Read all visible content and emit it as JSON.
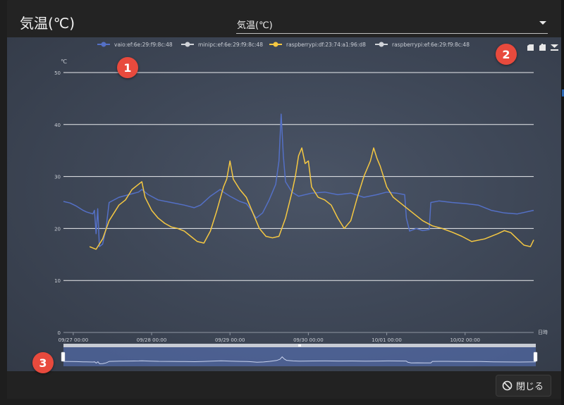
{
  "modal": {
    "title": "気温(℃)",
    "select_value": "気温(℃)",
    "close_label": "閉じる",
    "badges": [
      "1",
      "2",
      "3"
    ]
  },
  "chart_data": {
    "type": "line",
    "yunit": "℃",
    "xlabel": "日時",
    "ylim": [
      0,
      50
    ],
    "yticks": [
      0,
      10,
      20,
      30,
      40,
      50
    ],
    "xlim": [
      "09/26 21:00",
      "10/02 21:00"
    ],
    "xticks": [
      "09/27 00:00",
      "09/28 00:00",
      "09/29 00:00",
      "09/30 00:00",
      "10/01 00:00",
      "10/02 00:00"
    ],
    "legend_position": "top-center",
    "grid": true,
    "series": [
      {
        "name": "vaio:ef:6e:29:f9:8c:48",
        "color": "#5470c6",
        "points": [
          [
            "09/26 21:00",
            25.2
          ],
          [
            "09/26 23:00",
            24.9
          ],
          [
            "09/27 01:00",
            24.3
          ],
          [
            "09/27 03:00",
            23.5
          ],
          [
            "09/27 04:00",
            23.2
          ],
          [
            "09/27 05:00",
            23.0
          ],
          [
            "09/27 06:00",
            22.8
          ],
          [
            "09/27 06:30",
            23.5
          ],
          [
            "09/27 07:00",
            19.0
          ],
          [
            "09/27 07:30",
            23.8
          ],
          [
            "09/27 08:00",
            16.5
          ],
          [
            "09/27 09:00",
            17.0
          ],
          [
            "09/27 10:00",
            19.8
          ],
          [
            "09/27 11:00",
            25.0
          ],
          [
            "09/27 14:00",
            26.0
          ],
          [
            "09/27 17:00",
            26.5
          ],
          [
            "09/27 20:00",
            27.0
          ],
          [
            "09/27 21:00",
            27.5
          ],
          [
            "09/27 23:00",
            26.5
          ],
          [
            "09/28 02:00",
            25.5
          ],
          [
            "09/28 06:00",
            25.0
          ],
          [
            "09/28 10:00",
            24.5
          ],
          [
            "09/28 13:00",
            24.0
          ],
          [
            "09/28 15:00",
            24.5
          ],
          [
            "09/28 18:00",
            26.2
          ],
          [
            "09/28 21:00",
            27.5
          ],
          [
            "09/28 22:00",
            27.0
          ],
          [
            "09/29 00:00",
            26.2
          ],
          [
            "09/29 03:00",
            25.2
          ],
          [
            "09/29 05:00",
            24.8
          ],
          [
            "09/29 06:00",
            24.0
          ],
          [
            "09/29 08:00",
            22.0
          ],
          [
            "09/29 10:00",
            23.0
          ],
          [
            "09/29 12:00",
            25.5
          ],
          [
            "09/29 14:00",
            28.5
          ],
          [
            "09/29 15:00",
            33.0
          ],
          [
            "09/29 15:40",
            42.0
          ],
          [
            "09/29 16:20",
            34.0
          ],
          [
            "09/29 17:00",
            29.0
          ],
          [
            "09/29 19:00",
            27.0
          ],
          [
            "09/29 21:00",
            26.2
          ],
          [
            "09/30 01:00",
            26.8
          ],
          [
            "09/30 05:00",
            27.0
          ],
          [
            "09/30 09:00",
            26.5
          ],
          [
            "09/30 13:00",
            26.8
          ],
          [
            "09/30 17:00",
            26.0
          ],
          [
            "09/30 21:00",
            26.5
          ],
          [
            "10/01 00:00",
            27.0
          ],
          [
            "10/01 03:00",
            26.8
          ],
          [
            "10/01 05:30",
            26.5
          ],
          [
            "10/01 06:00",
            22.0
          ],
          [
            "10/01 07:00",
            19.5
          ],
          [
            "10/01 09:00",
            20.0
          ],
          [
            "10/01 11:00",
            19.6
          ],
          [
            "10/01 13:00",
            19.8
          ],
          [
            "10/01 13:30",
            25.0
          ],
          [
            "10/01 16:00",
            25.3
          ],
          [
            "10/01 20:00",
            25.0
          ],
          [
            "10/02 00:00",
            24.8
          ],
          [
            "10/02 04:00",
            24.5
          ],
          [
            "10/02 08:00",
            23.5
          ],
          [
            "10/02 12:00",
            23.0
          ],
          [
            "10/02 16:00",
            22.8
          ],
          [
            "10/02 21:00",
            23.5
          ]
        ]
      },
      {
        "name": "minipc:ef:6e:29:f9:8c:48",
        "color": "#d0d3d8",
        "points": []
      },
      {
        "name": "raspberrypi:df:23:74:a1:96:d8",
        "color": "#f5c842",
        "points": [
          [
            "09/27 05:00",
            16.5
          ],
          [
            "09/27 07:00",
            16.0
          ],
          [
            "09/27 09:00",
            18.0
          ],
          [
            "09/27 11:00",
            21.5
          ],
          [
            "09/27 14:00",
            24.5
          ],
          [
            "09/27 16:00",
            25.5
          ],
          [
            "09/27 18:00",
            27.5
          ],
          [
            "09/27 20:00",
            28.5
          ],
          [
            "09/27 21:00",
            29.0
          ],
          [
            "09/27 22:00",
            26.0
          ],
          [
            "09/28 00:00",
            23.5
          ],
          [
            "09/28 02:00",
            22.0
          ],
          [
            "09/28 04:00",
            21.0
          ],
          [
            "09/28 06:00",
            20.3
          ],
          [
            "09/28 08:00",
            20.0
          ],
          [
            "09/28 10:00",
            19.5
          ],
          [
            "09/28 12:00",
            18.5
          ],
          [
            "09/28 14:00",
            17.5
          ],
          [
            "09/28 16:00",
            17.2
          ],
          [
            "09/28 18:00",
            19.5
          ],
          [
            "09/28 20:00",
            23.5
          ],
          [
            "09/28 22:00",
            28.0
          ],
          [
            "09/28 23:00",
            29.5
          ],
          [
            "09/29 00:00",
            33.0
          ],
          [
            "09/29 01:00",
            29.5
          ],
          [
            "09/29 03:00",
            27.5
          ],
          [
            "09/29 05:00",
            26.0
          ],
          [
            "09/29 07:00",
            23.0
          ],
          [
            "09/29 09:00",
            20.0
          ],
          [
            "09/29 11:00",
            18.5
          ],
          [
            "09/29 13:00",
            18.2
          ],
          [
            "09/29 15:00",
            18.5
          ],
          [
            "09/29 17:00",
            22.0
          ],
          [
            "09/29 19:00",
            27.0
          ],
          [
            "09/29 20:00",
            30.0
          ],
          [
            "09/29 21:00",
            34.0
          ],
          [
            "09/29 22:00",
            35.5
          ],
          [
            "09/29 23:00",
            32.5
          ],
          [
            "09/30 00:00",
            33.0
          ],
          [
            "09/30 01:00",
            28.0
          ],
          [
            "09/30 03:00",
            26.0
          ],
          [
            "09/30 05:00",
            25.5
          ],
          [
            "09/30 07:00",
            24.5
          ],
          [
            "09/30 09:00",
            22.0
          ],
          [
            "09/30 11:00",
            20.0
          ],
          [
            "09/30 13:00",
            21.5
          ],
          [
            "09/30 15:00",
            26.0
          ],
          [
            "09/30 17:00",
            30.0
          ],
          [
            "09/30 19:00",
            33.0
          ],
          [
            "09/30 20:00",
            35.5
          ],
          [
            "09/30 21:00",
            33.5
          ],
          [
            "09/30 22:00",
            32.0
          ],
          [
            "10/01 00:00",
            28.0
          ],
          [
            "10/01 02:00",
            26.0
          ],
          [
            "10/01 05:00",
            24.5
          ],
          [
            "10/01 08:00",
            23.0
          ],
          [
            "10/01 11:00",
            21.5
          ],
          [
            "10/01 14:00",
            20.5
          ],
          [
            "10/01 17:00",
            20.0
          ],
          [
            "10/01 20:00",
            19.3
          ],
          [
            "10/01 23:00",
            18.5
          ],
          [
            "10/02 02:00",
            17.5
          ],
          [
            "10/02 06:00",
            18.0
          ],
          [
            "10/02 10:00",
            19.0
          ],
          [
            "10/02 12:00",
            19.6
          ],
          [
            "10/02 14:00",
            19.2
          ],
          [
            "10/02 16:00",
            18.0
          ],
          [
            "10/02 18:00",
            16.8
          ],
          [
            "10/02 20:00",
            16.5
          ],
          [
            "10/02 21:00",
            17.8
          ]
        ]
      },
      {
        "name": "raspberrypi:ef:6e:29:f9:8c:48",
        "color": "#d0d3d8",
        "points": []
      }
    ]
  }
}
